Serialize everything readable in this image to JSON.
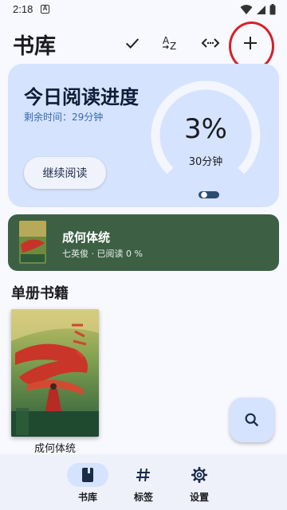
{
  "status": {
    "time": "2:18",
    "notif_letter": "A"
  },
  "header": {
    "title": "书库",
    "actions": [
      "check-icon",
      "sort-az-icon",
      "code-icon",
      "add-icon"
    ]
  },
  "progress": {
    "title": "今日阅读进度",
    "remaining": "剩余时间：29分钟",
    "continue_label": "继续阅读",
    "percent_text": "3%",
    "percent_value": 3,
    "minutes": "30分钟"
  },
  "recent": {
    "title": "成何体统",
    "meta": "七英俊 · 已阅读 0 %",
    "progress_value": 0
  },
  "section": {
    "title": "单册书籍"
  },
  "books": [
    {
      "title": "成何体统"
    }
  ],
  "nav": [
    {
      "label": "书库",
      "icon": "book-icon",
      "active": true
    },
    {
      "label": "标签",
      "icon": "hashtag-icon",
      "active": false
    },
    {
      "label": "设置",
      "icon": "gear-icon",
      "active": false
    }
  ],
  "colors": {
    "accent": "#d5e3ff",
    "card_green": "#3d6045",
    "annotation_red": "#d81f26"
  }
}
